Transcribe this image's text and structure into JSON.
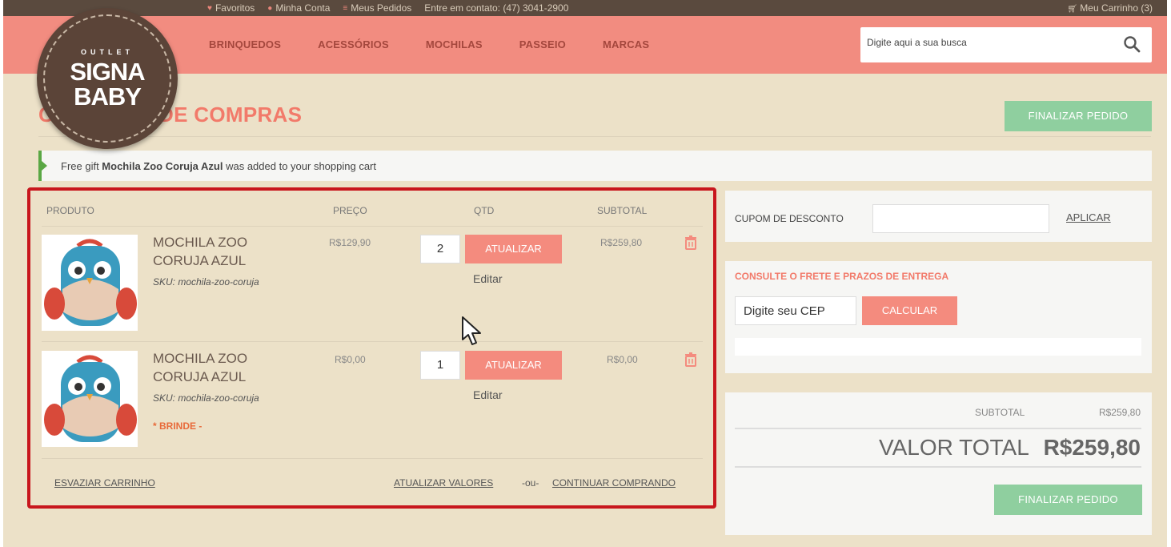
{
  "topbar": {
    "links": [
      "Favoritos",
      "Minha Conta",
      "Meus Pedidos",
      "Entre em contato: (47) 3041-2900"
    ],
    "cart_label": "Meu Carrinho (3)"
  },
  "logo": {
    "line1": "OUTLET",
    "line2": "SIGNA",
    "line3": "BABY"
  },
  "nav": {
    "items": [
      "BRINQUEDOS",
      "ACESSÓRIOS",
      "MOCHILAS",
      "PASSEIO",
      "MARCAS"
    ]
  },
  "search": {
    "placeholder": "Digite aqui a sua busca"
  },
  "page_title": "CARRINHO DE COMPRAS",
  "checkout_label": "FINALIZAR PEDIDO",
  "message": {
    "prefix": "Free gift ",
    "product": "Mochila Zoo Coruja Azul",
    "suffix": " was added to your shopping cart"
  },
  "cart": {
    "headers": {
      "product": "PRODUTO",
      "price": "PREÇO",
      "qty": "QTD",
      "subtotal": "SUBTOTAL"
    },
    "update_label": "ATUALIZAR",
    "edit_label": "Editar",
    "items": [
      {
        "name": "MOCHILA ZOO CORUJA AZUL",
        "sku": "SKU: mochila-zoo-coruja",
        "price": "R$129,90",
        "qty": "2",
        "subtotal": "R$259,80",
        "gift": ""
      },
      {
        "name": "MOCHILA ZOO CORUJA AZUL",
        "sku": "SKU: mochila-zoo-coruja",
        "price": "R$0,00",
        "qty": "1",
        "subtotal": "R$0,00",
        "gift": "* BRINDE -"
      }
    ],
    "empty_label": "ESVAZIAR CARRINHO",
    "update_values_label": "ATUALIZAR VALORES",
    "or_label": "-ou-",
    "continue_label": "CONTINUAR COMPRANDO"
  },
  "coupon": {
    "label": "CUPOM DE DESCONTO",
    "apply_label": "APLICAR"
  },
  "shipping": {
    "label": "CONSULTE O FRETE E PRAZOS DE ENTREGA",
    "placeholder": "Digite seu CEP",
    "calc_label": "CALCULAR"
  },
  "totals": {
    "subtotal_label": "SUBTOTAL",
    "subtotal_value": "R$259,80",
    "total_label": "VALOR TOTAL",
    "total_value": "R$259,80"
  },
  "colors": {
    "nav_bg": "#f28c80",
    "page_bg": "#ece1c8",
    "accent_coral": "#f48b7e",
    "green_button": "#8fcf9f",
    "highlight_border": "#c8161d",
    "topbar_bg": "#5a4a3e"
  }
}
